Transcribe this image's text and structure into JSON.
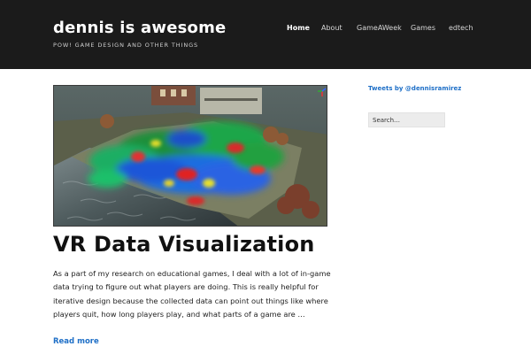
{
  "header": {
    "site_title": "dennis is awesome",
    "tagline": "POW! GAME DESIGN AND OTHER THINGS",
    "background": "#1b1b1b"
  },
  "nav": {
    "items": [
      {
        "label": "Home",
        "active": true
      },
      {
        "label": "About",
        "active": false
      },
      {
        "label": "GameAWeek",
        "active": false
      },
      {
        "label": "Games",
        "active": false
      },
      {
        "label": "edtech",
        "active": false
      }
    ]
  },
  "post": {
    "image_subject": "3D game level with heatmap overlay",
    "title": "VR Data Visualization",
    "excerpt": "As a part of my research on educational games, I deal with a lot of in-game data trying to figure out what players are doing. This is really helpful for iterative design because the collected data can point out things like where players quit, how long players play, and what parts of a game are …",
    "read_more": "Read more"
  },
  "sidebar": {
    "tweets_link": "Tweets by @dennisramirez",
    "search_placeholder": "Search…"
  },
  "colors": {
    "link": "#1e6fc7"
  }
}
